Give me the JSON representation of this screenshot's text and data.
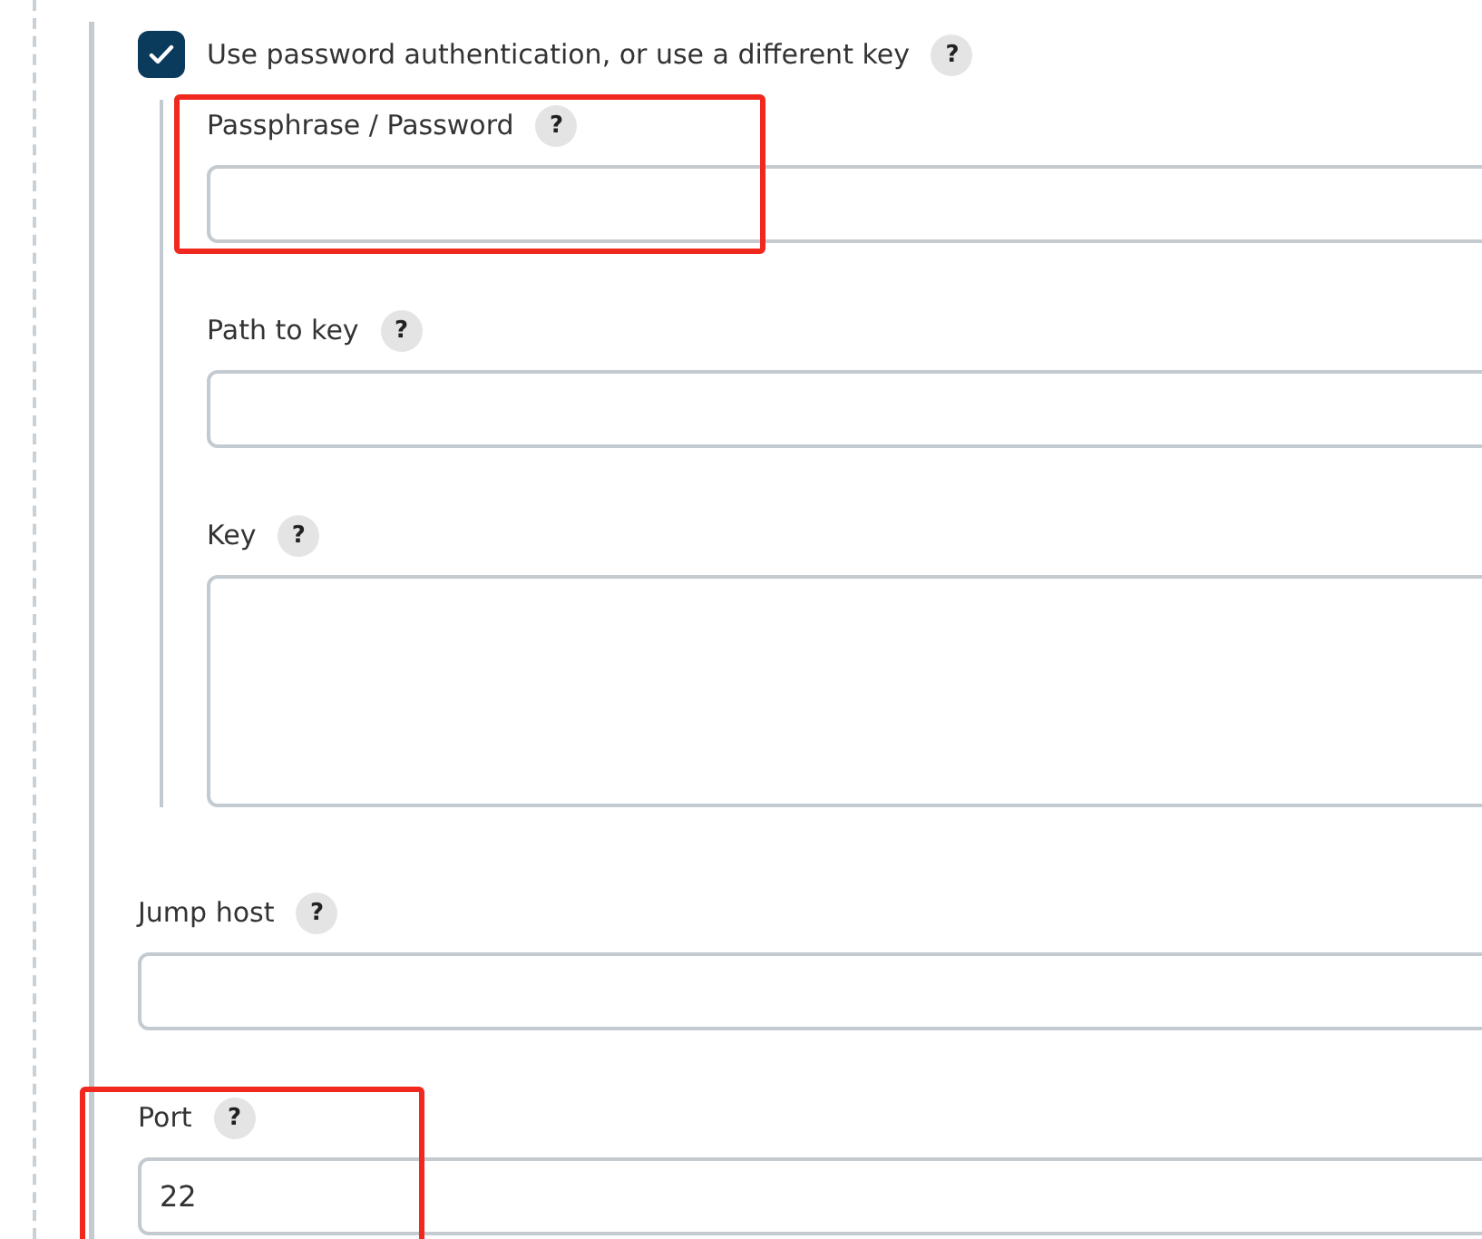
{
  "option": {
    "label": "Use password authentication, or use a different key",
    "help": "?",
    "checked": true,
    "fields": [
      {
        "label": "Passphrase / Password",
        "help": "?",
        "kind": "input",
        "highlighted": true
      },
      {
        "label": "Path to key",
        "help": "?",
        "kind": "input",
        "highlighted": false
      },
      {
        "label": "Key",
        "help": "?",
        "kind": "textarea",
        "highlighted": false
      }
    ]
  },
  "fields": [
    {
      "label": "Jump host",
      "help": "?",
      "kind": "input",
      "highlighted": false
    },
    {
      "label": "Port",
      "help": "?",
      "kind": "input",
      "value": "22",
      "highlighted": true
    }
  ]
}
